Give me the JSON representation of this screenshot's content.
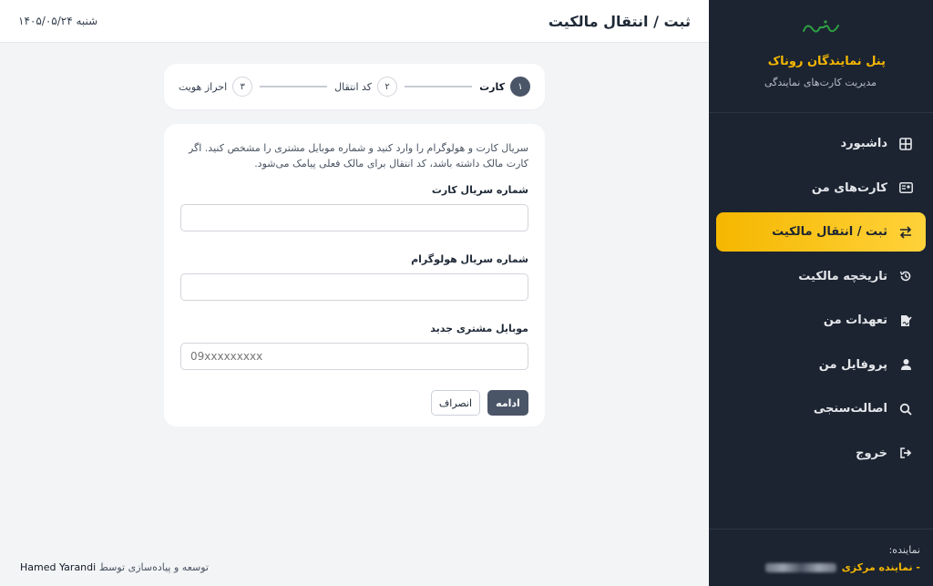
{
  "header": {
    "title": "ثبت / انتقال مالکیت",
    "date": "شنبه ۱۴۰۵/۰۵/۲۴"
  },
  "sidebar": {
    "logo_text": "روناک",
    "title": "پنل نمایندگان روناک",
    "subtitle": "مدیریت کارت‌های نمایندگی",
    "items": [
      {
        "label": "داشبورد",
        "icon": "grid-icon",
        "active": false
      },
      {
        "label": "کارت‌های من",
        "icon": "id-card-icon",
        "active": false
      },
      {
        "label": "ثبت / انتقال مالکیت",
        "icon": "swap-arrows-icon",
        "active": true
      },
      {
        "label": "تاریخچه مالکیت",
        "icon": "history-icon",
        "active": false
      },
      {
        "label": "تعهدات من",
        "icon": "signature-doc-icon",
        "active": false
      },
      {
        "label": "پروفایل من",
        "icon": "user-icon",
        "active": false
      },
      {
        "label": "اصالت‌سنجی",
        "icon": "search-icon",
        "active": false
      },
      {
        "label": "خروج",
        "icon": "logout-icon",
        "active": false
      }
    ],
    "representative_label": "نماینده:",
    "representative_value": "- نماینده مرکزی"
  },
  "stepper": {
    "steps": [
      {
        "num": "۱",
        "label": "کارت",
        "active": true
      },
      {
        "num": "۲",
        "label": "کد انتقال",
        "active": false
      },
      {
        "num": "۳",
        "label": "احراز هویت",
        "active": false
      }
    ]
  },
  "form": {
    "intro": "سریال کارت و هولوگرام را وارد کنید و شماره موبایل مشتری را مشخص کنید. اگر کارت مالک داشته باشد، کد انتقال برای مالک فعلی پیامک می‌شود.",
    "card_serial_label": "شماره سریال کارت",
    "card_serial_value": "",
    "hologram_label": "شماره سریال هولوگرام",
    "hologram_value": "",
    "mobile_label": "موبایل مشتری جدید",
    "mobile_placeholder": "09xxxxxxxxx",
    "continue_label": "ادامه",
    "cancel_label": "انصراف"
  },
  "footer": {
    "text": "توسعه و پیاده‌سازی توسط",
    "author": "Hamed Yarandi"
  },
  "colors": {
    "sidebar_bg": "#1c2431",
    "accent": "#f5b700",
    "primary_button": "#4b5568"
  }
}
